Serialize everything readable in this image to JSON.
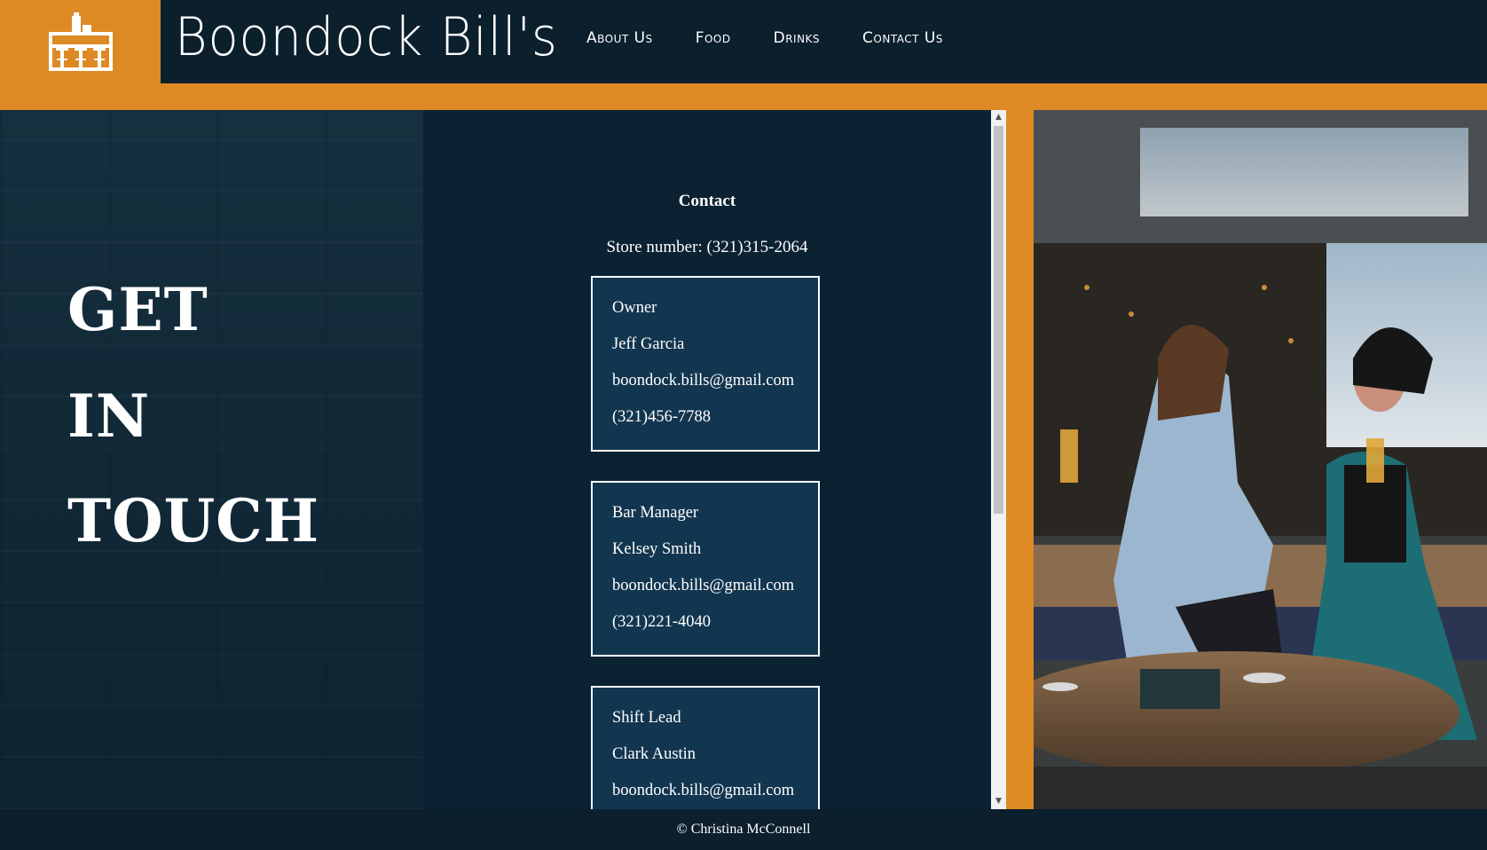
{
  "header": {
    "brand": "Boondock Bill's",
    "logo_icon": "bar-counter-icon",
    "nav": [
      "About Us",
      "Food",
      "Drinks",
      "Contact Us"
    ]
  },
  "hero": {
    "lines": [
      "GET",
      "IN",
      "TOUCH"
    ]
  },
  "contact": {
    "title": "Contact",
    "store": "Store number: (321)315-2064",
    "cards": [
      {
        "role": "Owner",
        "name": "Jeff Garcia",
        "email": "boondock.bills@gmail.com",
        "phone": "(321)456-7788"
      },
      {
        "role": "Bar Manager",
        "name": "Kelsey Smith",
        "email": "boondock.bills@gmail.com",
        "phone": "(321)221-4040"
      },
      {
        "role": "Shift Lead",
        "name": "Clark Austin",
        "email": "boondock.bills@gmail.com",
        "phone": ""
      }
    ]
  },
  "footer": {
    "copyright": "© Christina McConnell"
  },
  "colors": {
    "accent": "#dd8a25",
    "navy": "#0b2233",
    "card": "#133650"
  }
}
